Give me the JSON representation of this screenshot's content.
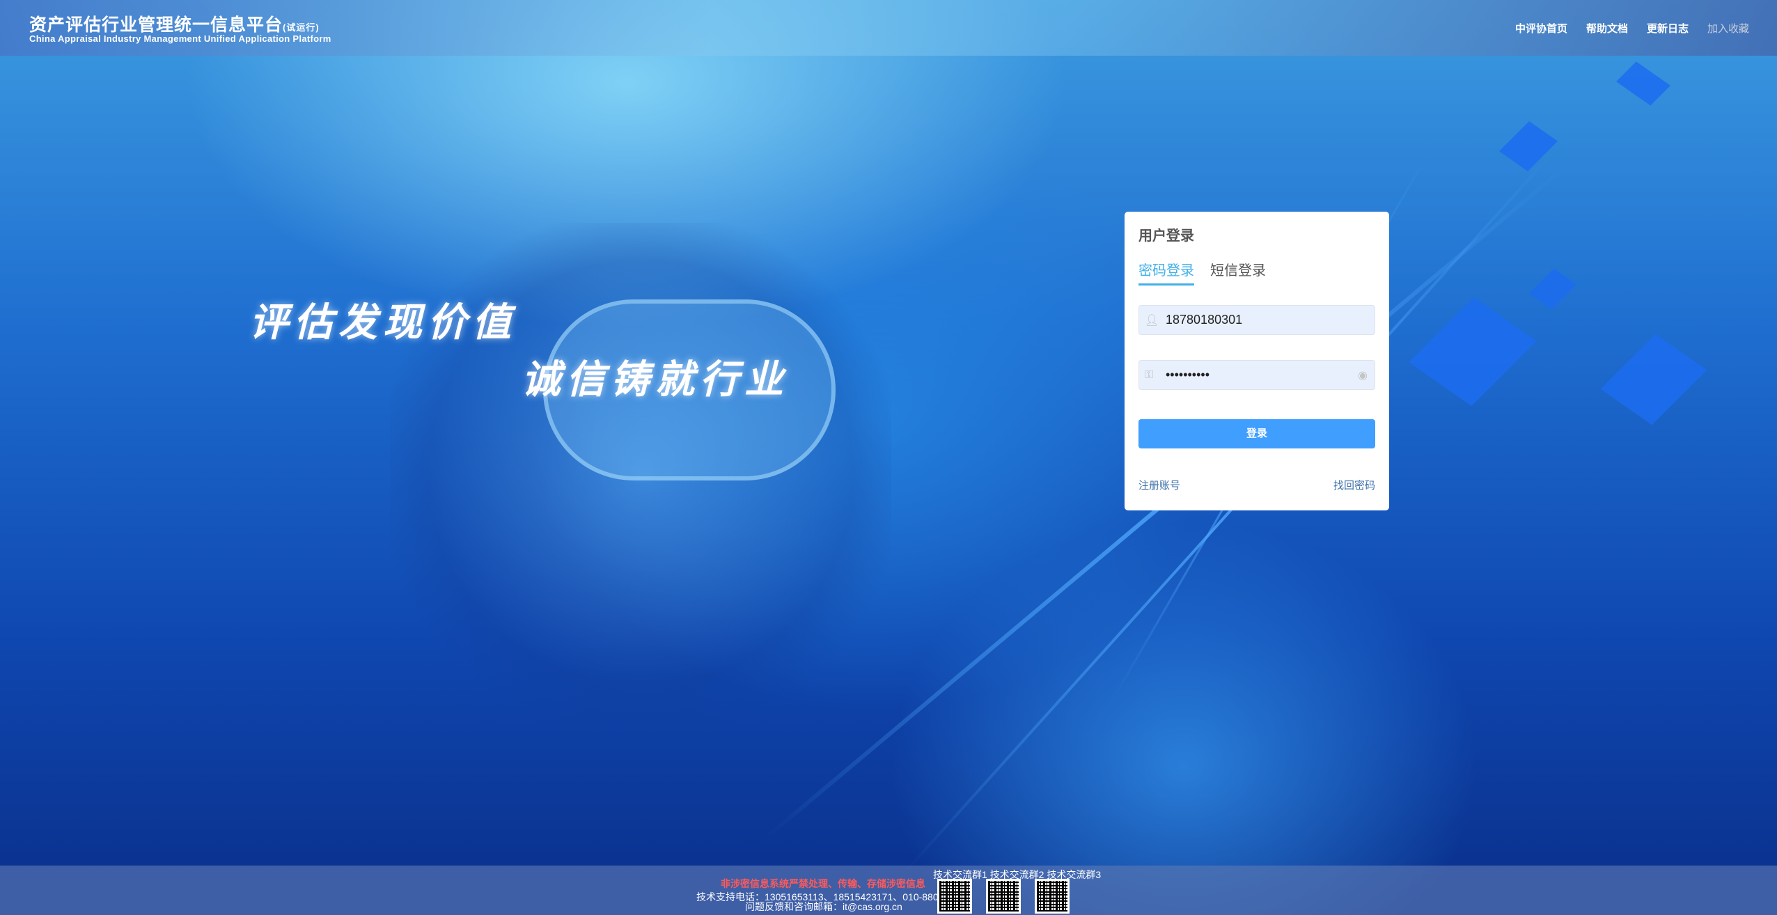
{
  "header": {
    "title_cn": "资产评估行业管理统一信息平台",
    "title_suffix": "(试运行)",
    "title_en": "China Appraisal Industry Management Unified  Application  Platform",
    "nav": [
      "中评协首页",
      "帮助文档",
      "更新日志",
      "加入收藏"
    ]
  },
  "hero": {
    "slogan1": "评估发现价值",
    "slogan2": "诚信铸就行业"
  },
  "login": {
    "title": "用户登录",
    "tabs": [
      "密码登录",
      "短信登录"
    ],
    "active_tab": "密码登录",
    "username": "18780180301",
    "password": "••••••••••",
    "submit": "登录",
    "register": "注册账号",
    "forgot": "找回密码",
    "accent": "#409eff"
  },
  "footer": {
    "warning": "非涉密信息系统严禁处理、传输、存储涉密信息",
    "phone": "技术支持电话：13051653113、18515423171、010-88014204",
    "email": "问题反馈和咨询邮箱：it@cas.org.cn",
    "qr_labels": [
      "技术交流群1",
      "技术交流群2",
      "技术交流群3"
    ]
  }
}
